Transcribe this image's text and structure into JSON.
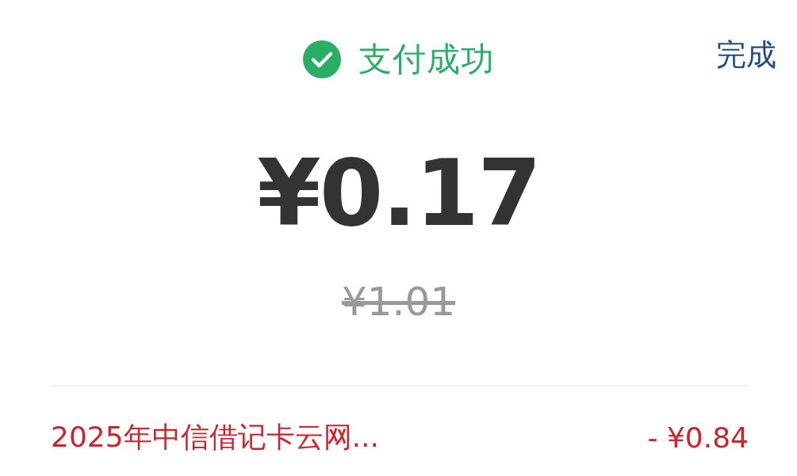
{
  "header": {
    "status": "支付成功",
    "success": true,
    "done_button": "完成"
  },
  "amount": "¥0.17",
  "original_amount": "¥1.01",
  "discounts": [
    {
      "label": "2025年中信借记卡云网...",
      "value": "- ¥0.84"
    }
  ]
}
